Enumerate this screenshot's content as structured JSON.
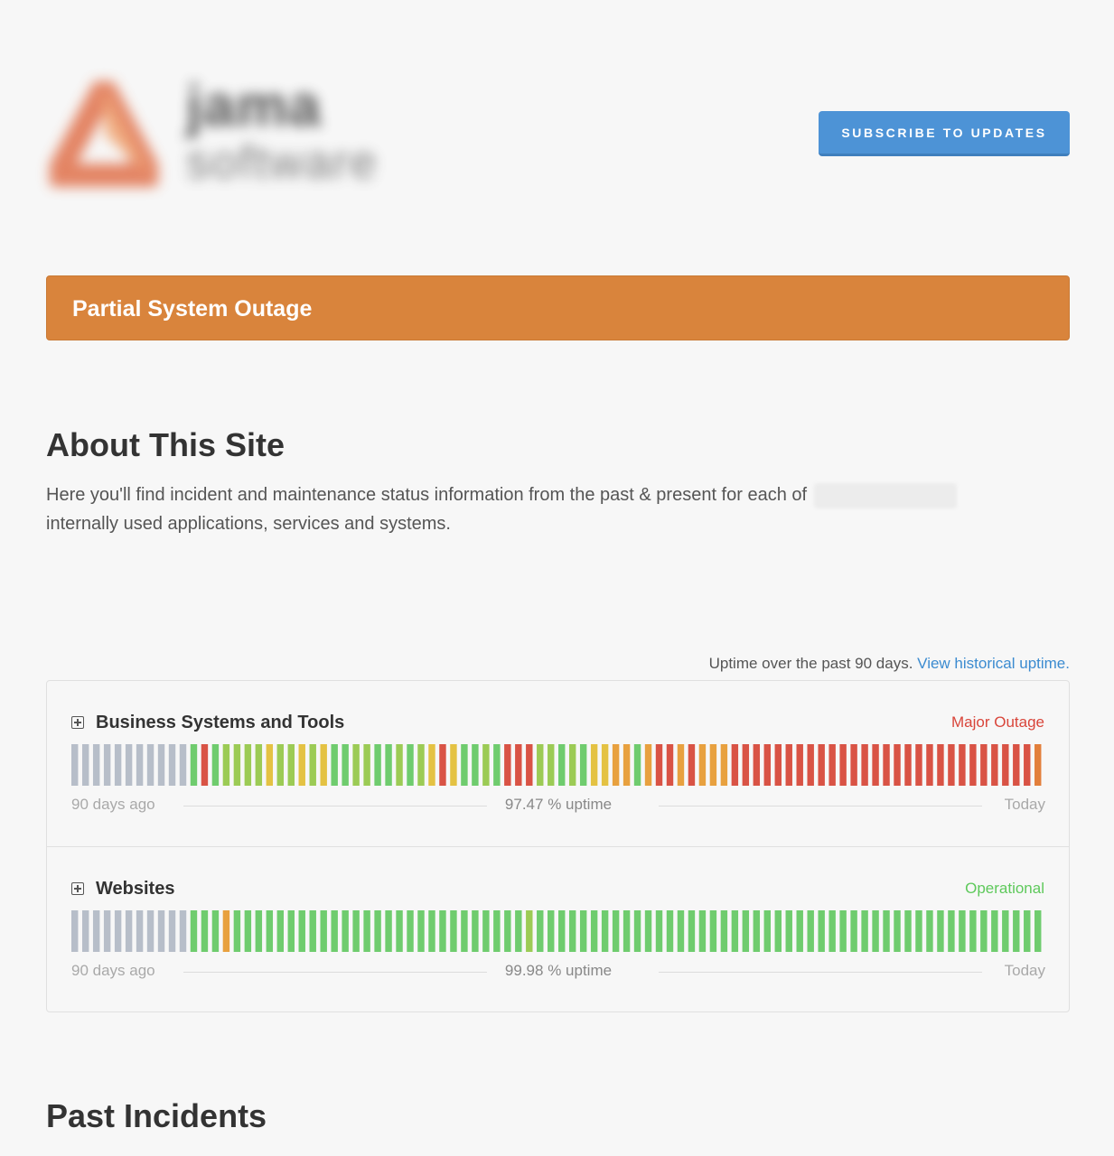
{
  "header": {
    "logo": {
      "word1": "jama",
      "word2": "software"
    },
    "subscribe_label": "SUBSCRIBE TO UPDATES"
  },
  "banner": {
    "text": "Partial System Outage",
    "color": "#d9843c"
  },
  "about": {
    "title": "About This Site",
    "text_before": "Here you'll find incident and maintenance status information from the past & present for each of",
    "text_after": "internally used applications, services and systems."
  },
  "uptime": {
    "note": "Uptime over the past 90 days.",
    "link": "View historical uptime."
  },
  "colors": {
    "nodata": "#b7bec9",
    "green": "#6fcc6e",
    "lightgreen": "#9ccb55",
    "yellow": "#e4c243",
    "orange": "#e8a13f",
    "darkorange": "#e27f3b",
    "red": "#d95345",
    "major_outage_text": "#d9453a",
    "operational_text": "#5ec95b"
  },
  "components": [
    {
      "name": "Business Systems and Tools",
      "status": "Major Outage",
      "status_color": "#d9453a",
      "start_label": "90 days ago",
      "uptime_label": "97.47 % uptime",
      "end_label": "Today",
      "days": [
        "nodata",
        "nodata",
        "nodata",
        "nodata",
        "nodata",
        "nodata",
        "nodata",
        "nodata",
        "nodata",
        "nodata",
        "nodata",
        "green",
        "red",
        "green",
        "lightgreen",
        "lightgreen",
        "lightgreen",
        "lightgreen",
        "yellow",
        "lightgreen",
        "lightgreen",
        "yellow",
        "lightgreen",
        "yellow",
        "green",
        "green",
        "lightgreen",
        "lightgreen",
        "green",
        "green",
        "lightgreen",
        "green",
        "lightgreen",
        "yellow",
        "red",
        "yellow",
        "green",
        "green",
        "lightgreen",
        "green",
        "red",
        "red",
        "red",
        "lightgreen",
        "lightgreen",
        "green",
        "lightgreen",
        "green",
        "yellow",
        "yellow",
        "orange",
        "orange",
        "green",
        "orange",
        "red",
        "red",
        "orange",
        "red",
        "orange",
        "orange",
        "orange",
        "red",
        "red",
        "red",
        "red",
        "red",
        "red",
        "red",
        "red",
        "red",
        "red",
        "red",
        "red",
        "red",
        "red",
        "red",
        "red",
        "red",
        "red",
        "red",
        "red",
        "red",
        "red",
        "red",
        "red",
        "red",
        "red",
        "red",
        "red",
        "darkorange"
      ]
    },
    {
      "name": "Websites",
      "status": "Operational",
      "status_color": "#5ec95b",
      "start_label": "90 days ago",
      "uptime_label": "99.98 % uptime",
      "end_label": "Today",
      "days": [
        "nodata",
        "nodata",
        "nodata",
        "nodata",
        "nodata",
        "nodata",
        "nodata",
        "nodata",
        "nodata",
        "nodata",
        "nodata",
        "green",
        "green",
        "green",
        "orange",
        "green",
        "green",
        "green",
        "green",
        "green",
        "green",
        "green",
        "green",
        "green",
        "green",
        "green",
        "green",
        "green",
        "green",
        "green",
        "green",
        "green",
        "green",
        "green",
        "green",
        "green",
        "green",
        "green",
        "green",
        "green",
        "green",
        "green",
        "lightgreen",
        "green",
        "green",
        "green",
        "green",
        "green",
        "green",
        "green",
        "green",
        "green",
        "green",
        "green",
        "green",
        "green",
        "green",
        "green",
        "green",
        "green",
        "green",
        "green",
        "green",
        "green",
        "green",
        "green",
        "green",
        "green",
        "green",
        "green",
        "green",
        "green",
        "green",
        "green",
        "green",
        "green",
        "green",
        "green",
        "green",
        "green",
        "green",
        "green",
        "green",
        "green",
        "green",
        "green",
        "green",
        "green",
        "green",
        "green"
      ]
    }
  ],
  "past_incidents": {
    "title": "Past Incidents"
  }
}
